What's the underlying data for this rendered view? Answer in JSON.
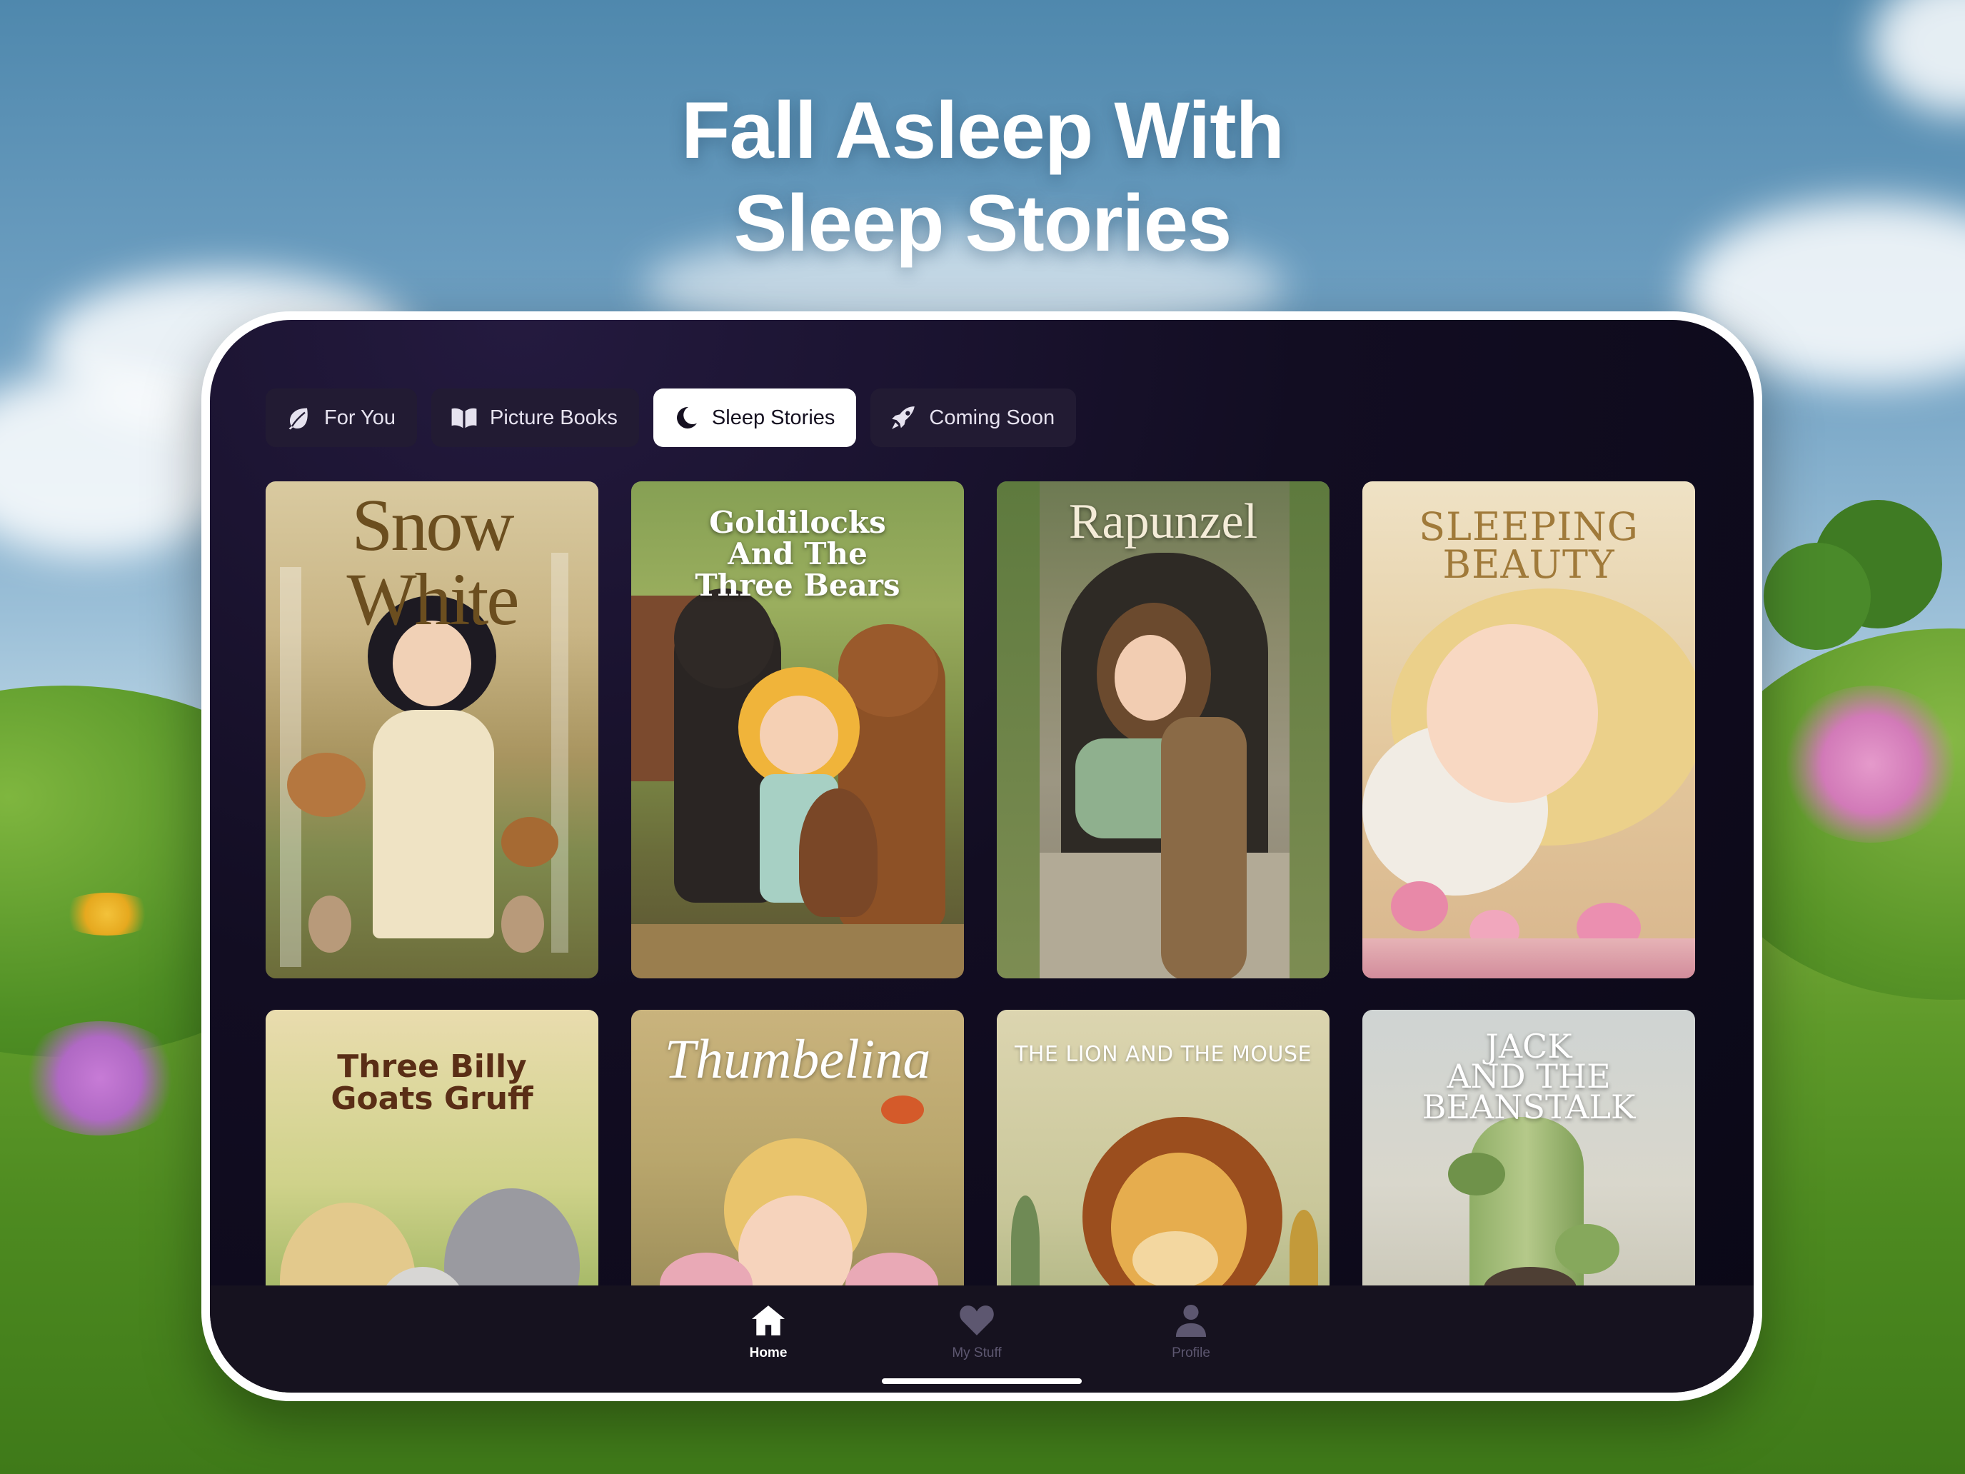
{
  "headline": {
    "line1": "Fall Asleep With",
    "line2": "Sleep Stories"
  },
  "tabs": [
    {
      "label": "For You",
      "icon": "leaf-icon",
      "active": false
    },
    {
      "label": "Picture Books",
      "icon": "open-book-icon",
      "active": false
    },
    {
      "label": "Sleep Stories",
      "icon": "moon-icon",
      "active": true
    },
    {
      "label": "Coming Soon",
      "icon": "rocket-icon",
      "active": false
    }
  ],
  "stories": [
    {
      "title": "Snow White",
      "title_color": "#6b4e1f"
    },
    {
      "title": "Goldilocks\nAnd The\nThree Bears",
      "title_color": "#ffffff"
    },
    {
      "title": "Rapunzel",
      "title_color": "#f4ecd8"
    },
    {
      "title": "SLEEPING\nBEAUTY",
      "title_color": "#a07a3a"
    },
    {
      "title": "Three Billy\nGoats Gruff",
      "title_color": "#5a2e16"
    },
    {
      "title": "Thumbelina",
      "title_color": "#ffffff"
    },
    {
      "title": "THE LION AND THE MOUSE",
      "title_color": "#ffffff"
    },
    {
      "title": "JACK\nAND THE\nBEANSTALK",
      "title_color": "#ffffff"
    }
  ],
  "bottom_nav": [
    {
      "label": "Home",
      "icon": "home-icon",
      "active": true
    },
    {
      "label": "My Stuff",
      "icon": "heart-icon",
      "active": false
    },
    {
      "label": "Profile",
      "icon": "person-icon",
      "active": false
    }
  ],
  "colors": {
    "screen_bg": "#120d22",
    "tab_bg": "#221b33",
    "tab_active_bg": "#ffffff",
    "device_frame": "#ffffff"
  }
}
